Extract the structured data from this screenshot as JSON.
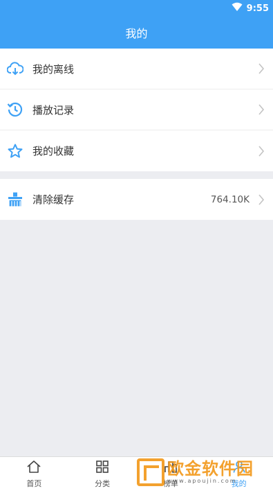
{
  "status_bar": {
    "time": "9:55",
    "wifi_icon": "wifi-icon",
    "battery_icon": "battery-icon"
  },
  "header": {
    "title": "我的"
  },
  "menu": [
    {
      "label": "我的离线",
      "icon": "cloud-download-icon"
    },
    {
      "label": "播放记录",
      "icon": "history-icon"
    },
    {
      "label": "我的收藏",
      "icon": "star-icon"
    }
  ],
  "cache": {
    "label": "清除缓存",
    "icon": "brush-icon",
    "size": "764.10K"
  },
  "tabs": [
    {
      "label": "首页",
      "icon": "home-icon"
    },
    {
      "label": "分类",
      "icon": "grid-icon"
    },
    {
      "label": "榜单",
      "icon": "ranking-icon"
    },
    {
      "label": "我的",
      "icon": "user-icon",
      "active": true
    }
  ],
  "watermark": {
    "title": "欧金软件园",
    "url": "www.apoujin.com"
  },
  "colors": {
    "primary": "#3ea1f5",
    "background": "#ecedf1",
    "watermark": "#f39a1d"
  }
}
